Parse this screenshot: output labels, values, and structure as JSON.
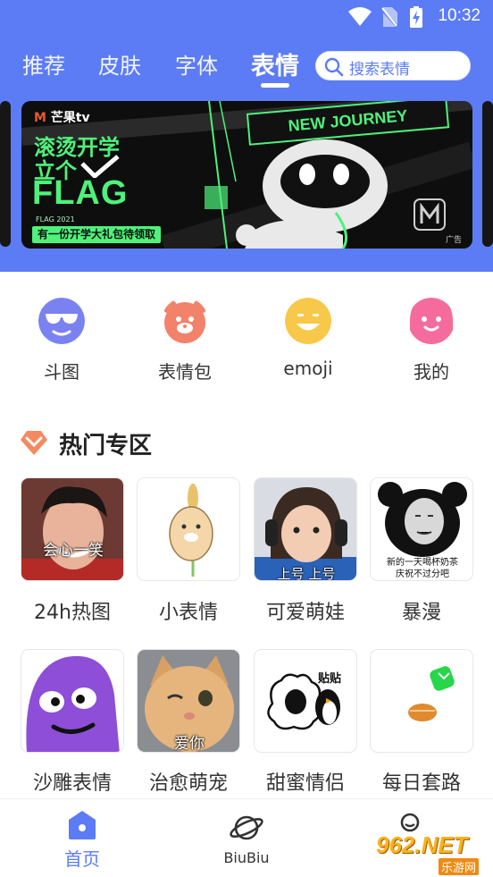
{
  "status_bar": {
    "time": "10:32",
    "icons": [
      "wifi-icon",
      "no-sim-icon",
      "battery-charging-icon"
    ]
  },
  "top_tabs": [
    {
      "label": "推荐",
      "active": false
    },
    {
      "label": "皮肤",
      "active": false
    },
    {
      "label": "字体",
      "active": false
    },
    {
      "label": "表情",
      "active": true
    }
  ],
  "search": {
    "placeholder": "搜索表情",
    "icon": "search-icon"
  },
  "banner": {
    "brand": "芒果tv",
    "line1": "滚烫开学",
    "line2": "立个",
    "flag": "FLAG",
    "year": "FLAG 2021",
    "subline": "有一份开学大礼包待领取",
    "headline": "NEW JOURNEY",
    "ad_tag": "广告"
  },
  "categories": [
    {
      "label": "斗图",
      "icon": "cool-face-icon",
      "color": "#7a82f2"
    },
    {
      "label": "表情包",
      "icon": "bear-face-icon",
      "color": "#f3826a"
    },
    {
      "label": "emoji",
      "icon": "smile-face-icon",
      "color": "#f8c84a"
    },
    {
      "label": "我的",
      "icon": "ghost-face-icon",
      "color": "#f56c9c"
    }
  ],
  "section": {
    "title": "热门专区",
    "icon": "heart-diamond-icon",
    "icon_color": "#f5895f"
  },
  "tiles": [
    {
      "label": "24h热图",
      "caption": "会心一笑"
    },
    {
      "label": "小表情",
      "caption": ""
    },
    {
      "label": "可爱萌娃",
      "caption": "上号 上号"
    },
    {
      "label": "暴漫",
      "caption_lines": [
        "新的一天喝杯奶茶",
        "庆祝不过分吧"
      ]
    },
    {
      "label": "沙雕表情",
      "caption": ""
    },
    {
      "label": "治愈萌宠",
      "caption": "爱你"
    },
    {
      "label": "甜蜜情侣",
      "caption": "贴贴"
    },
    {
      "label": "每日套路",
      "caption": ""
    }
  ],
  "bottom_nav": [
    {
      "label": "首页",
      "icon": "home-icon",
      "active": true
    },
    {
      "label": "BiuBiu",
      "icon": "planet-icon",
      "active": false
    },
    {
      "label": "",
      "icon": "profile-icon",
      "active": false
    }
  ],
  "watermark": {
    "main": "962.NET",
    "sub": "乐游网"
  },
  "colors": {
    "primary": "#5c7cf5",
    "banner_green": "#4ef27a"
  }
}
